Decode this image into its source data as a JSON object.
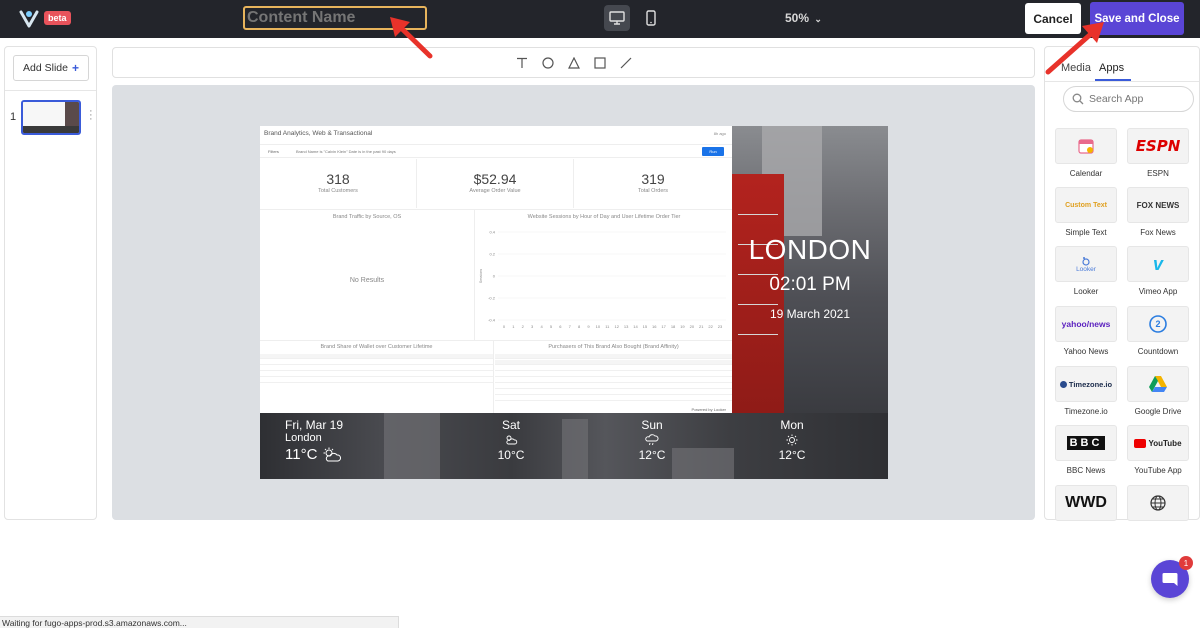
{
  "app": {
    "beta_label": "beta",
    "content_name_placeholder": "Content Name",
    "zoom_label": "50%",
    "cancel_label": "Cancel",
    "save_label": "Save and Close",
    "accent_color": "#5a45d6"
  },
  "slides": {
    "add_label": "Add Slide",
    "add_icon": "plus-icon",
    "items": [
      {
        "number": "1"
      }
    ]
  },
  "toolbar": {
    "tools": [
      "text-icon",
      "circle-icon",
      "triangle-icon",
      "square-icon",
      "line-icon"
    ]
  },
  "dashboard": {
    "title": "Brand Analytics, Web & Transactional",
    "title_right": "8h ago",
    "filters_label": "Filters",
    "filter_text": "Brand Name is \"Calvin Klein\"    Date is in the past 90 days",
    "run_label": "Run",
    "kpis": [
      {
        "value": "318",
        "label": "Total Customers"
      },
      {
        "value": "$52.94",
        "label": "Average Order Value"
      },
      {
        "value": "319",
        "label": "Total Orders"
      }
    ],
    "traffic_title": "Brand Traffic by Source, OS",
    "no_results": "No Results",
    "sessions_title": "Website Sessions by Hour of Day and User Lifetime Order Tier",
    "sessions_yticks": [
      "0.4",
      "0.2",
      "0",
      "-0.2",
      "-0.4"
    ],
    "sessions_xticks": [
      "0",
      "1",
      "2",
      "3",
      "4",
      "5",
      "6",
      "7",
      "8",
      "9",
      "10",
      "11",
      "12",
      "13",
      "14",
      "15",
      "16",
      "17",
      "18",
      "19",
      "20",
      "21",
      "22",
      "23"
    ],
    "sessions_ylabel": "Sessions",
    "wallet_title": "Brand Share of Wallet over Customer Lifetime",
    "affinity_title": "Purchasers of This Brand Also Bought (Brand Affinity)",
    "powered_by": "Powered by Looker"
  },
  "london": {
    "city": "LONDON",
    "time": "02:01 PM",
    "date": "19 March 2021"
  },
  "weather": {
    "today": {
      "day": "Fri, Mar 19",
      "city": "London",
      "temp": "11°C",
      "icon": "cloud-sun-icon"
    },
    "forecast": [
      {
        "day": "Sat",
        "temp": "10°C",
        "icon": "cloud-sun-icon"
      },
      {
        "day": "Sun",
        "temp": "12°C",
        "icon": "cloud-rain-icon"
      },
      {
        "day": "Mon",
        "temp": "12°C",
        "icon": "sun-icon"
      }
    ]
  },
  "apps_panel": {
    "tab_media": "Media",
    "tab_apps": "Apps",
    "search_placeholder": "Search App",
    "apps": [
      {
        "label": "Calendar",
        "icon": "calendar-icon"
      },
      {
        "label": "ESPN",
        "icon": "espn-logo",
        "logo_text": "ESPN"
      },
      {
        "label": "Simple Text",
        "icon": "custom-text-icon",
        "logo_text": "Custom Text"
      },
      {
        "label": "Fox News",
        "icon": "fox-news-logo",
        "logo_text": "FOX NEWS"
      },
      {
        "label": "Looker",
        "icon": "looker-logo",
        "logo_text": "Looker"
      },
      {
        "label": "Vimeo App",
        "icon": "vimeo-logo",
        "logo_text": "v"
      },
      {
        "label": "Yahoo News",
        "icon": "yahoo-news-logo",
        "logo_text": "yahoo/news"
      },
      {
        "label": "Countdown",
        "icon": "countdown-icon",
        "logo_text": "2"
      },
      {
        "label": "Timezone.io",
        "icon": "timezone-logo",
        "logo_text": "Timezone.io"
      },
      {
        "label": "Google Drive",
        "icon": "google-drive-icon"
      },
      {
        "label": "BBC News",
        "icon": "bbc-logo",
        "logo_text": "BBC"
      },
      {
        "label": "YouTube App",
        "icon": "youtube-logo",
        "logo_text": "YouTube"
      },
      {
        "label": "",
        "icon": "wwd-logo",
        "logo_text": "WWD"
      },
      {
        "label": "",
        "icon": "globe-icon"
      }
    ]
  },
  "status_bar": {
    "text": "Waiting for fugo-apps-prod.s3.amazonaws.com..."
  },
  "chat": {
    "badge": "1"
  }
}
